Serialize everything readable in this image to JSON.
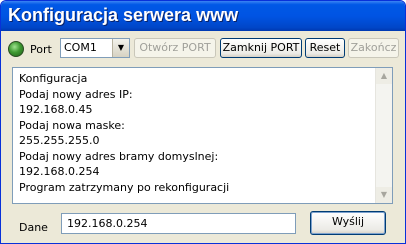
{
  "window": {
    "title": "Konfiguracja serwera www"
  },
  "port": {
    "label": "Port",
    "selected": "COM1",
    "led_color": "#3f9a32"
  },
  "toolbar": {
    "open_port": "Otwórz PORT",
    "close_port": "Zamknij PORT",
    "reset": "Reset",
    "finish": "Zakończ"
  },
  "log": {
    "lines": [
      "Konfiguracja",
      "Podaj nowy adres IP:",
      "192.168.0.45",
      "Podaj nowa maske:",
      "255.255.255.0",
      "Podaj nowy adres bramy domyslnej:",
      "192.168.0.254",
      "Program zatrzymany po rekonfiguracji"
    ]
  },
  "input": {
    "label": "Dane",
    "value": "192.168.0.254"
  },
  "send": {
    "label": "Wyślij"
  }
}
